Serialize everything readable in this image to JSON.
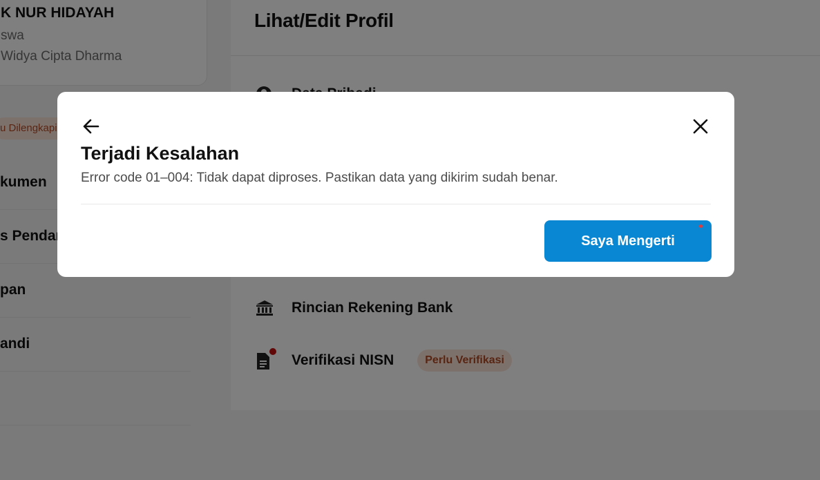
{
  "sidebar": {
    "profile": {
      "name": "K NUR HIDAYAH",
      "role": "swa",
      "school": "Widya Cipta Dharma"
    },
    "status_badge": "u Dilengkapi",
    "menu": [
      {
        "label": "kumen"
      },
      {
        "label": "s Pendan"
      },
      {
        "label": "pan"
      },
      {
        "label": "andi"
      },
      {
        "label": ""
      }
    ]
  },
  "main": {
    "title": "Lihat/Edit Profil",
    "items": [
      {
        "label": "Data Pribadi",
        "icon": "person-icon"
      },
      {
        "label": "Rincian Rekening Bank",
        "icon": "bank-icon"
      },
      {
        "label": "Verifikasi NISN",
        "icon": "document-icon",
        "badge": "Perlu Verifikasi"
      }
    ]
  },
  "modal": {
    "title": "Terjadi Kesalahan",
    "message": "Error code 01–004: Tidak dapat diproses. Pastikan data yang dikirim sudah benar.",
    "primary_label": "Saya Mengerti",
    "back_icon": "arrow-left-icon",
    "close_icon": "close-icon"
  },
  "colors": {
    "primary": "#0a87d2",
    "badge_bg": "#fbe3d9",
    "badge_text": "#b04a24",
    "alert_dot": "#c40f0f"
  }
}
